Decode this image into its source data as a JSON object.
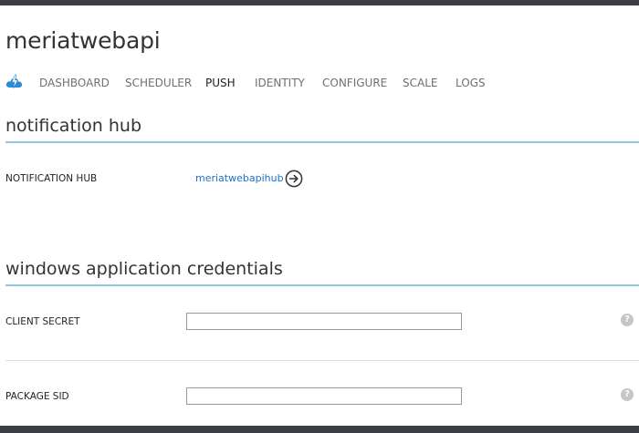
{
  "header": {
    "title": "meriatwebapi"
  },
  "nav": {
    "logo_icon": "cloud-lightning-icon",
    "items": [
      {
        "label": "DASHBOARD",
        "active": false
      },
      {
        "label": "SCHEDULER",
        "active": false
      },
      {
        "label": "PUSH",
        "active": true
      },
      {
        "label": "IDENTITY",
        "active": false
      },
      {
        "label": "CONFIGURE",
        "active": false
      },
      {
        "label": "SCALE",
        "active": false
      },
      {
        "label": "LOGS",
        "active": false
      }
    ]
  },
  "notification_section": {
    "title": "notification hub",
    "field_label": "NOTIFICATION HUB",
    "hub_name": "meriatwebapihub",
    "navigate_icon": "arrow-right-circle-icon"
  },
  "credentials_section": {
    "title": "windows application credentials",
    "client_secret": {
      "label": "CLIENT SECRET",
      "value": "",
      "help_icon": "question-icon",
      "help_glyph": "?"
    },
    "package_sid": {
      "label": "PACKAGE SID",
      "value": "",
      "help_icon": "question-icon",
      "help_glyph": "?"
    }
  },
  "colors": {
    "accent": "#1a73c4",
    "section_line": "#93c4e4",
    "chrome": "#3b3f45"
  }
}
